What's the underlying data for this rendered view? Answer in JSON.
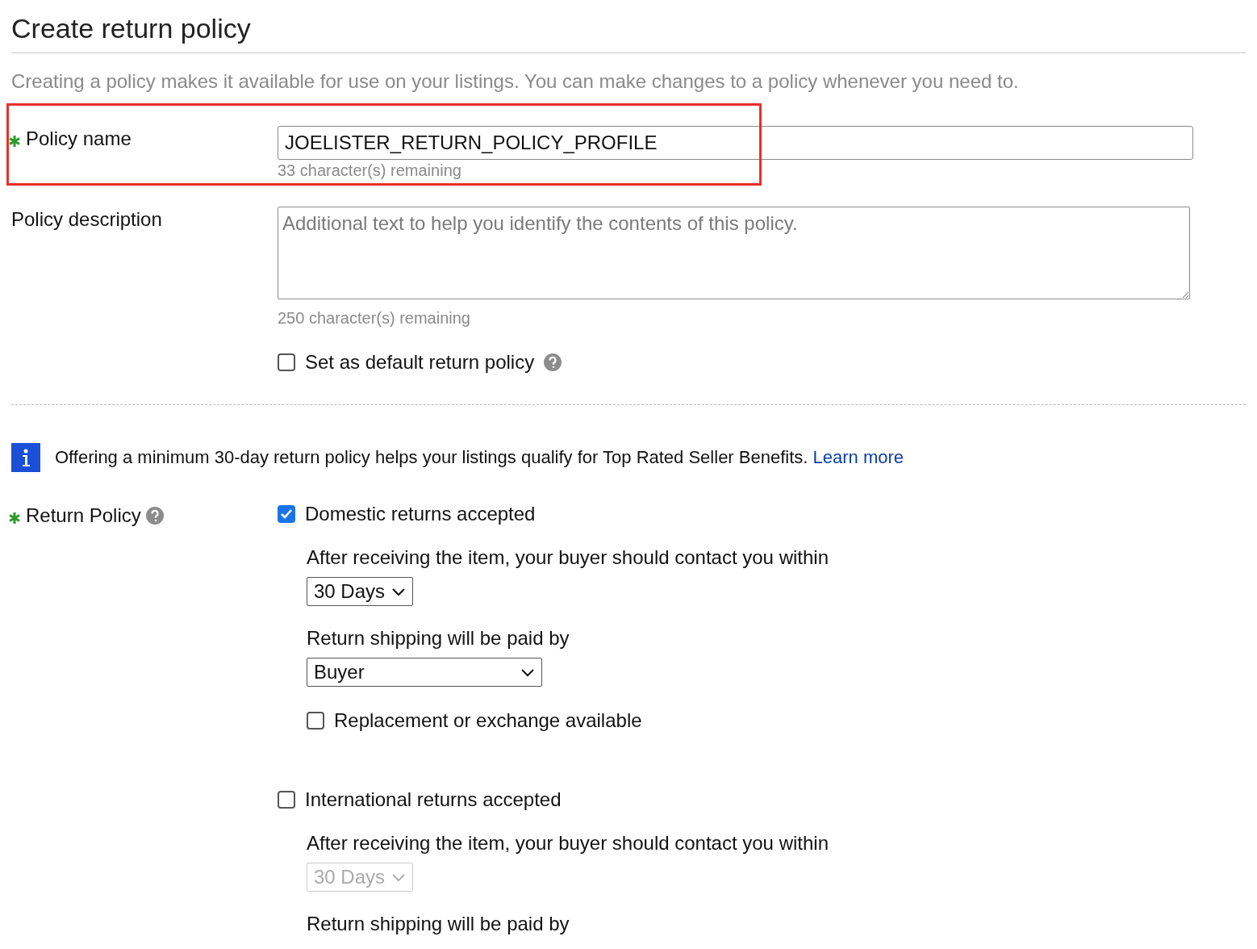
{
  "title": "Create return policy",
  "intro": "Creating a policy makes it available for use on your listings. You can make changes to a policy whenever you need to.",
  "policy_name": {
    "label": "Policy name",
    "required": true,
    "value": "JOELISTER_RETURN_POLICY_PROFILE",
    "remaining": "33 character(s) remaining",
    "highlighted": true
  },
  "policy_description": {
    "label": "Policy description",
    "required": false,
    "placeholder": "Additional text to help you identify the contents of this policy.",
    "remaining": "250 character(s) remaining"
  },
  "default_policy": {
    "label": "Set as default return policy",
    "checked": false
  },
  "notice": {
    "text": "Offering a minimum 30-day return policy helps your listings qualify for Top Rated Seller Benefits.",
    "link": "Learn more"
  },
  "return_policy": {
    "label": "Return Policy",
    "required": true,
    "sections": [
      {
        "label": "Domestic returns accepted",
        "checked": true,
        "contact_label": "After receiving the item, your buyer should contact you within",
        "contact_value": "30 Days",
        "disabled": false,
        "paid_by_label": "Return shipping will be paid by",
        "paid_by_value": "Buyer",
        "replacement": {
          "label": "Replacement or exchange available",
          "checked": false
        }
      },
      {
        "label": "International returns accepted",
        "checked": false,
        "contact_label": "After receiving the item, your buyer should contact you within",
        "contact_value": "30 Days",
        "disabled": true,
        "paid_by_label": "Return shipping will be paid by"
      }
    ]
  }
}
